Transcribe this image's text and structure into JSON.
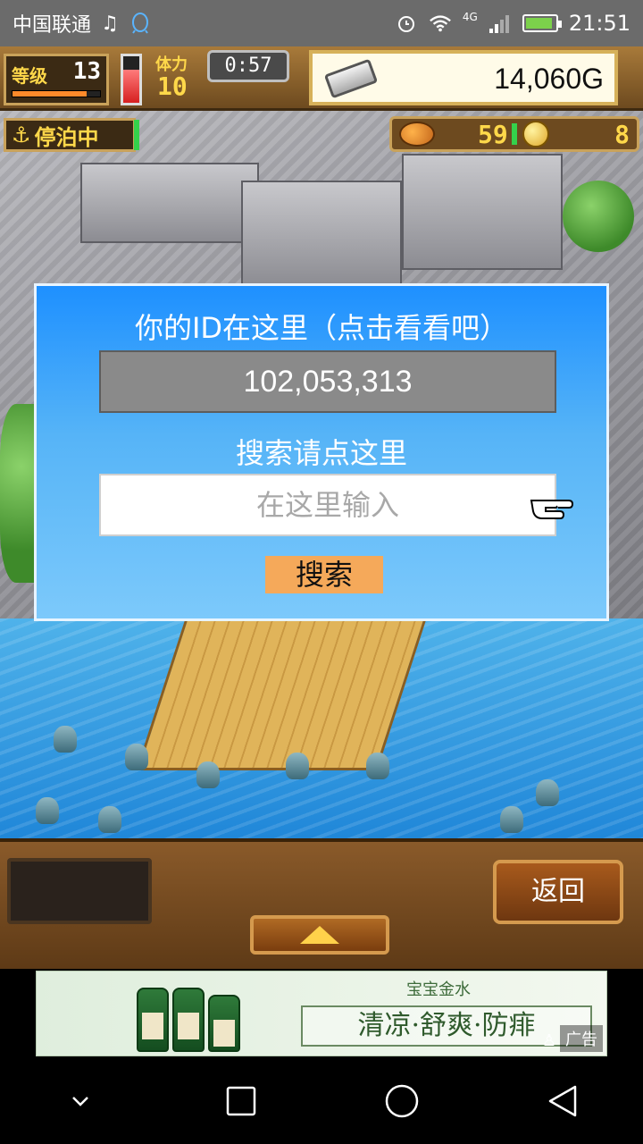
{
  "status_bar": {
    "carrier": "中国联通",
    "network": "4G",
    "time": "21:51",
    "battery_level": 0.9,
    "icons": [
      "music-icon",
      "qq-icon",
      "alarm-icon",
      "wifi-icon",
      "signal-icon",
      "battery-charging-icon"
    ]
  },
  "hud": {
    "level_label": "等级",
    "level_value": "13",
    "level_progress": 0.85,
    "stamina_label": "体力",
    "stamina_value": "10",
    "stamina_fill": 0.72,
    "timer": "0:57",
    "money": "14,060G",
    "docked_label": "停泊中",
    "food_value": "59",
    "coin_value": "8"
  },
  "dialog": {
    "title": "你的ID在这里（点击看看吧）",
    "player_id": "102,053,313",
    "search_title": "搜索请点这里",
    "search_placeholder": "在这里输入",
    "search_button": "搜索"
  },
  "bottom_panel": {
    "back_button": "返回",
    "expand_icon": "up-triangle-icon"
  },
  "ad": {
    "tagline": "宝宝金水",
    "slogan": "清凉·舒爽·防痱",
    "label": "广告"
  },
  "navbar": {
    "icons": [
      "chevron-down-icon",
      "square-recent-icon",
      "circle-home-icon",
      "triangle-back-icon"
    ]
  },
  "colors": {
    "dialog_top": "#1e90ff",
    "id_box": "#8a8a8a",
    "search_button": "#f5a95a",
    "hud_gold": "#ffd84a"
  }
}
